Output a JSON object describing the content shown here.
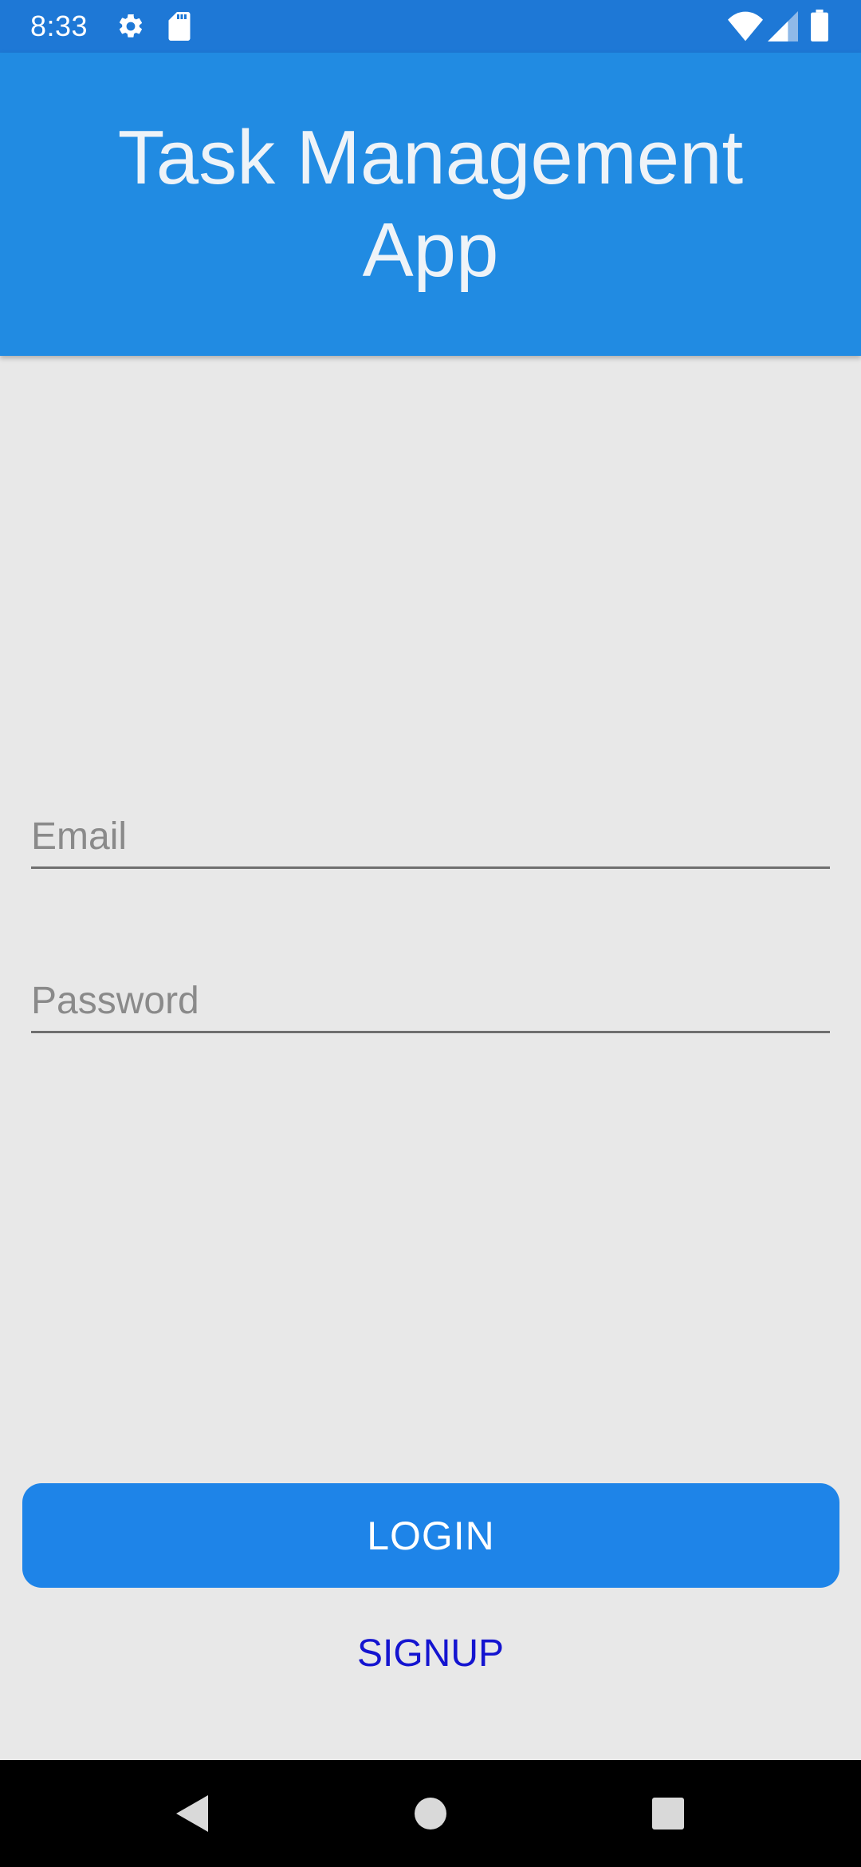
{
  "status_bar": {
    "time": "8:33",
    "icons": [
      "settings-icon",
      "sd-card-icon",
      "wifi-icon",
      "signal-icon",
      "battery-icon"
    ],
    "background_color": "#1e78d6"
  },
  "app_bar": {
    "title": "Task Management App",
    "background_color": "#218be2"
  },
  "form": {
    "email": {
      "placeholder": "Email",
      "value": ""
    },
    "password": {
      "placeholder": "Password",
      "value": ""
    }
  },
  "actions": {
    "login_label": "LOGIN",
    "signup_label": "SIGNUP",
    "login_color": "#1e84e8",
    "signup_color": "#1414d0"
  },
  "nav_bar": {
    "buttons": [
      "back-icon",
      "home-icon",
      "recents-icon"
    ]
  }
}
